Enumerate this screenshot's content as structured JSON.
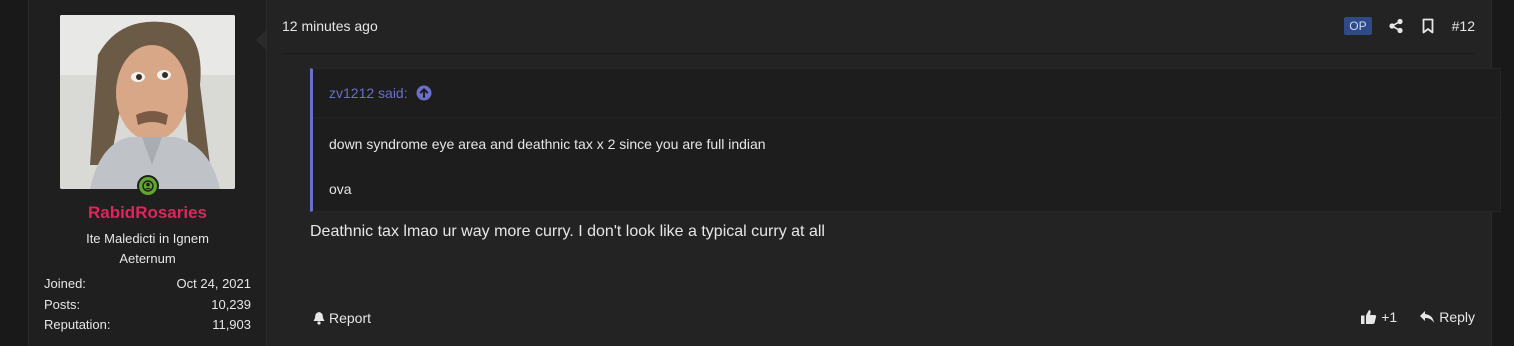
{
  "user": {
    "username": "RabidRosaries",
    "title": "Ite Maledicti in Ignem Aeternum",
    "stats": [
      {
        "label": "Joined:",
        "value": "Oct 24, 2021"
      },
      {
        "label": "Posts:",
        "value": "10,239"
      },
      {
        "label": "Reputation:",
        "value": "11,903"
      }
    ],
    "online": true
  },
  "post": {
    "date": "12 minutes ago",
    "op_badge": "OP",
    "number": "#12",
    "quote": {
      "author": "zv1212 said:",
      "lines": [
        "down syndrome eye area and deathnic tax x 2 since you are full indian",
        "ova"
      ]
    },
    "message": "Deathnic tax lmao ur way more curry. I don't look like a typical curry at all",
    "footer": {
      "report": "Report",
      "reaction_count": "+1",
      "reply": "Reply"
    }
  },
  "colors": {
    "username": "#e0245e",
    "quote_accent": "#6a6fc9",
    "op_badge_bg": "#2e4a8a",
    "online": "#5fa82d"
  },
  "icons": {
    "share": "share-icon",
    "bookmark": "bookmark-icon",
    "quote_up": "arrow-up-circle-icon",
    "report": "bell-icon",
    "like": "thumbs-up-icon",
    "reply": "reply-icon",
    "online": "user-online-icon"
  }
}
